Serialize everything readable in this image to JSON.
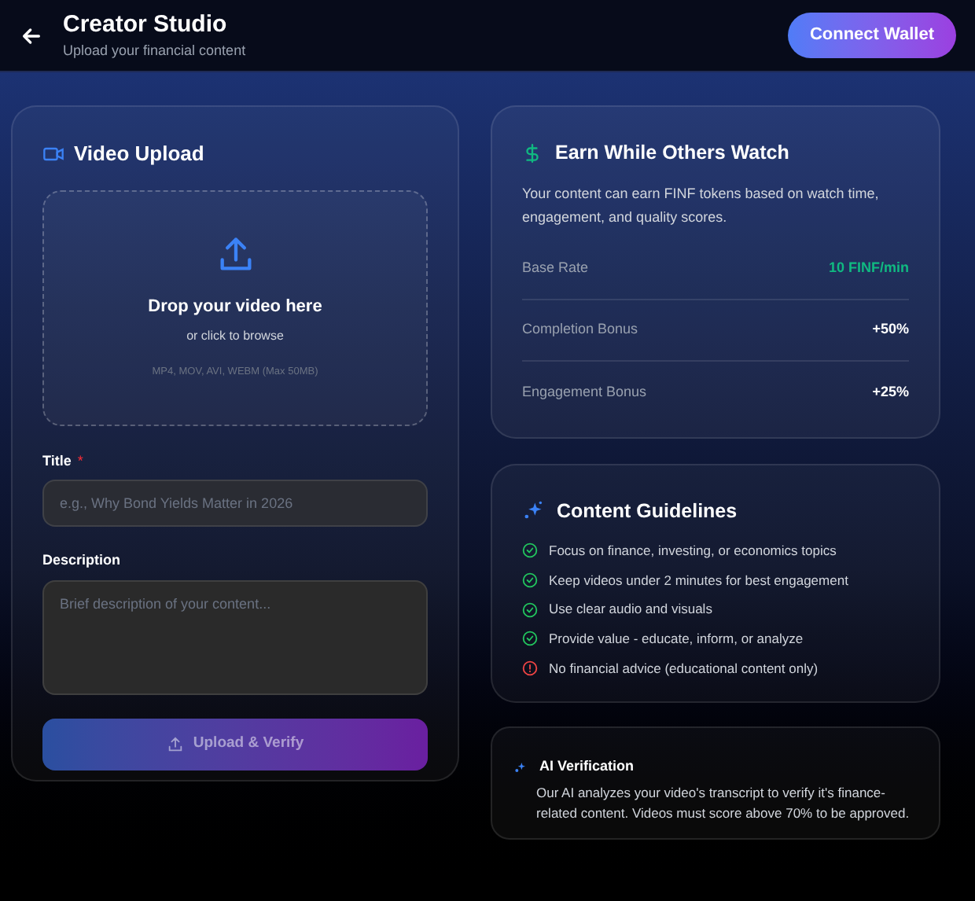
{
  "header": {
    "title": "Creator Studio",
    "subtitle": "Upload your financial content",
    "action": "Connect Wallet"
  },
  "upload": {
    "title": "Video Upload",
    "drop_title": "Drop your video here",
    "drop_hint": "or click to browse",
    "formats": "MP4, MOV, AVI, WEBM (Max 50MB)",
    "title_label": "Title",
    "required_mark": "*",
    "title_placeholder": "e.g., Why Bond Yields Matter in 2026",
    "description_label": "Description",
    "description_placeholder": "Brief description of your content...",
    "submit": {
      "label": "Upload & Verify",
      "disabled": true
    }
  },
  "earn": {
    "title": "Earn While Others Watch",
    "text": "Your content can earn FINF tokens based on watch time, engagement, and quality scores.",
    "rates": [
      {
        "label": "Base Rate",
        "value": "10 FINF/min",
        "kind": "accent"
      },
      {
        "label": "Completion Bonus",
        "value": "+50%",
        "kind": "plain"
      },
      {
        "label": "Engagement Bonus",
        "value": "+25%",
        "kind": "plain"
      }
    ]
  },
  "guidelines": {
    "title": "Content Guidelines",
    "items": [
      {
        "text": "Focus on finance, investing, or economics topics",
        "kind": "ok"
      },
      {
        "text": "Keep videos under 2 minutes for best engagement",
        "kind": "ok"
      },
      {
        "text": "Use clear audio and visuals",
        "kind": "ok"
      },
      {
        "text": "Provide value - educate, inform, or analyze",
        "kind": "ok"
      },
      {
        "text": "No financial advice (educational content only)",
        "kind": "warning"
      }
    ]
  },
  "verification": {
    "title": "AI Verification",
    "text": "Our AI analyzes your video's transcript to verify it's finance-related content. Videos must score above 70% to be approved."
  }
}
